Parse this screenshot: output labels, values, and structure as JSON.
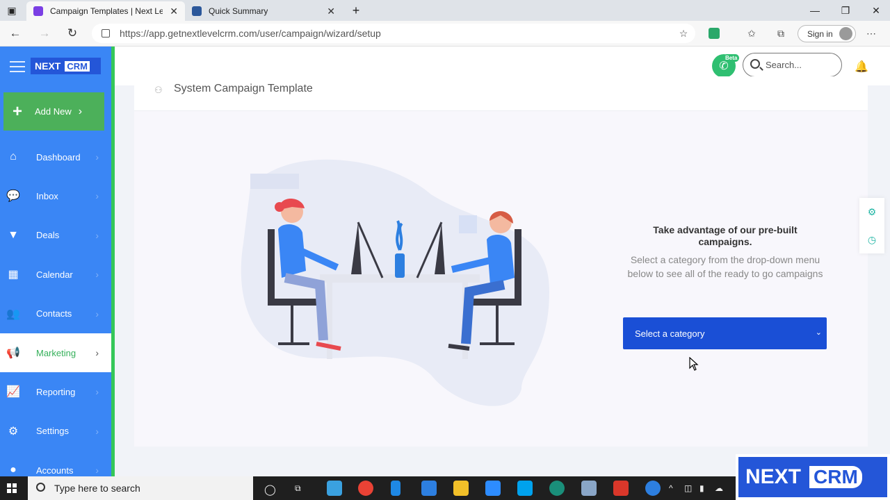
{
  "browser": {
    "tabs": [
      {
        "title": "Campaign Templates | Next Leve",
        "active": true,
        "favicon_color": "#7b3fe4"
      },
      {
        "title": "Quick Summary",
        "active": false,
        "favicon_color": "#2b579a"
      }
    ],
    "new_tab_label": "+",
    "window_controls": {
      "minimize": "—",
      "restore": "❐",
      "close": "✕"
    },
    "url": "https://app.getnextlevelcrm.com/user/campaign/wizard/setup",
    "sign_in_label": "Sign in"
  },
  "sidebar": {
    "logo_text": "NEXT",
    "logo_crm": "CRM",
    "add_new_label": "Add New",
    "items": [
      {
        "label": "Dashboard",
        "icon": "home-icon",
        "glyph": "⌂"
      },
      {
        "label": "Inbox",
        "icon": "chat-icon",
        "glyph": "💬"
      },
      {
        "label": "Deals",
        "icon": "filter-icon",
        "glyph": "▼"
      },
      {
        "label": "Calendar",
        "icon": "calendar-icon",
        "glyph": "▦"
      },
      {
        "label": "Contacts",
        "icon": "users-icon",
        "glyph": "👥"
      },
      {
        "label": "Marketing",
        "icon": "megaphone-icon",
        "glyph": "📢",
        "active": true
      },
      {
        "label": "Reporting",
        "icon": "chart-line-icon",
        "glyph": "📈"
      },
      {
        "label": "Settings",
        "icon": "gears-icon",
        "glyph": "⚙"
      },
      {
        "label": "Accounts",
        "icon": "account-icon",
        "glyph": "●"
      }
    ]
  },
  "topbar": {
    "beta_label": "Beta",
    "search_placeholder": "Search..."
  },
  "page": {
    "title": "System Campaign Template",
    "promo_title": "Take advantage of our pre-built campaigns.",
    "promo_desc_line1": "Select a category from the drop-down menu",
    "promo_desc_line2": "below to see all of the ready to go campaigns",
    "select_label": "Select a category"
  },
  "taskbar": {
    "search_placeholder": "Type here to search"
  },
  "watermark": {
    "text": "NEXT",
    "crm": "CRM"
  },
  "colors": {
    "sidebar": "#3a86f5",
    "accent_green": "#35c759",
    "select_blue": "#1a4fd6"
  }
}
